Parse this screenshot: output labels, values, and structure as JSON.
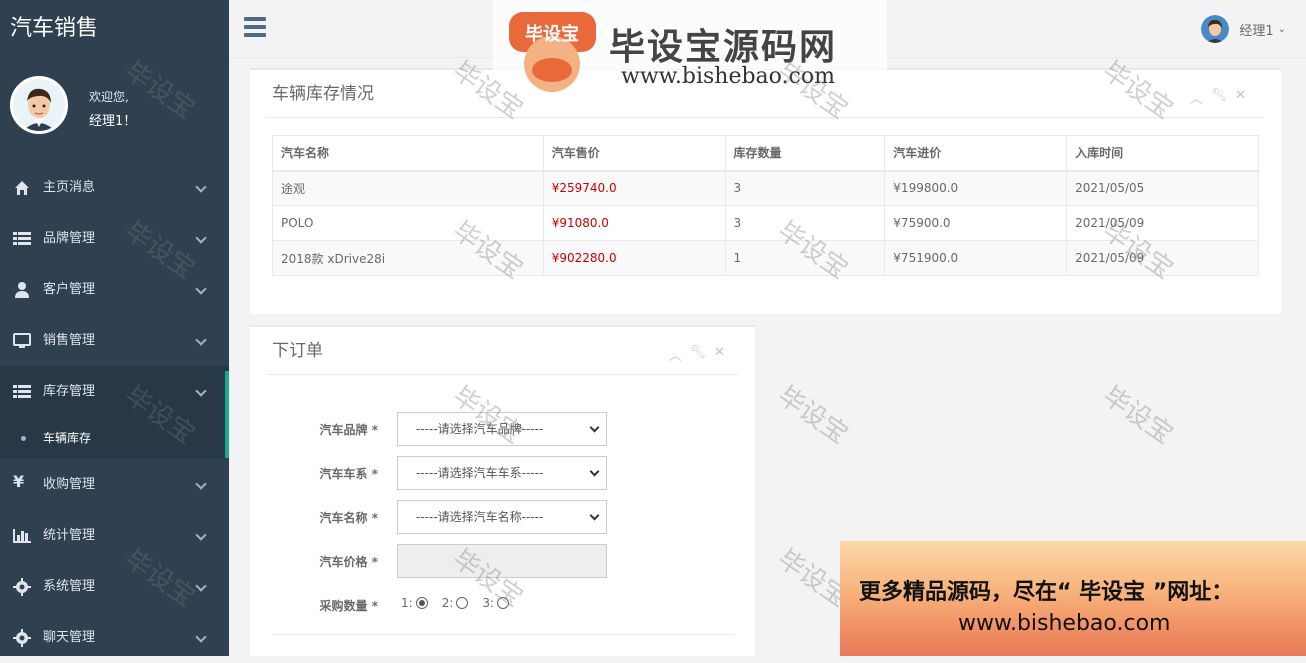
{
  "app": {
    "brand": "汽车销售"
  },
  "profile": {
    "welcome": "欢迎您,",
    "name": "经理1！"
  },
  "sidebar": {
    "items": [
      {
        "label": "主页消息",
        "icon": "home-icon"
      },
      {
        "label": "品牌管理",
        "icon": "list-icon"
      },
      {
        "label": "客户管理",
        "icon": "user-icon"
      },
      {
        "label": "销售管理",
        "icon": "monitor-icon"
      },
      {
        "label": "库存管理",
        "icon": "list-icon"
      },
      {
        "label": "收购管理",
        "icon": "yen-icon"
      },
      {
        "label": "统计管理",
        "icon": "bar-chart-icon"
      },
      {
        "label": "系统管理",
        "icon": "gear-icon"
      },
      {
        "label": "聊天管理",
        "icon": "gear-icon"
      }
    ],
    "sub_item": "车辆库存"
  },
  "topbar": {
    "user": "经理1"
  },
  "inventory": {
    "title": "车辆库存情况",
    "headers": [
      "汽车名称",
      "汽车售价",
      "库存数量",
      "汽车进价",
      "入库时间"
    ],
    "rows": [
      [
        "途观",
        "¥259740.0",
        "3",
        "¥199800.0",
        "2021/05/05"
      ],
      [
        "POLO",
        "¥91080.0",
        "3",
        "¥75900.0",
        "2021/05/09"
      ],
      [
        "2018款 xDrive28i",
        "¥902280.0",
        "1",
        "¥751900.0",
        "2021/05/09"
      ]
    ]
  },
  "order": {
    "title": "下订单",
    "brand_label": "汽车品牌 *",
    "brand_value": "-----请选择汽车品牌-----",
    "series_label": "汽车车系 *",
    "series_value": "-----请选择汽车车系-----",
    "name_label": "汽车名称 *",
    "name_value": "-----请选择汽车名称-----",
    "price_label": "汽车价格 *",
    "qty_label": "采购数量 *",
    "qty_options": [
      "1:",
      "2:",
      "3:"
    ],
    "qty_selected": "1"
  },
  "watermark": {
    "title": "毕设宝源码网",
    "url": "www.bishebao.com",
    "stamp": "毕设宝",
    "promo_line1": "更多精品源码，尽在“ 毕设宝 ”网址：",
    "promo_line2": "www.bishebao.com"
  },
  "colors": {
    "sidebar": "#2f4050",
    "accent": "#19aa8d",
    "price": "#cc0000"
  }
}
